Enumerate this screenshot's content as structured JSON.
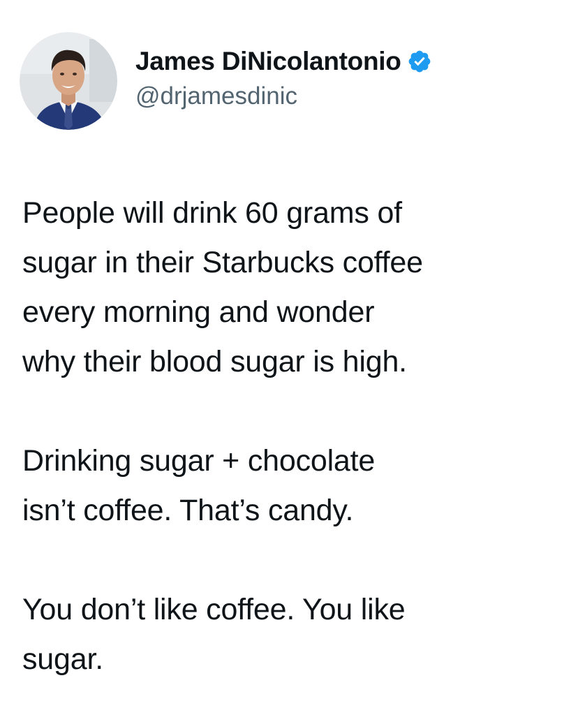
{
  "author": {
    "display_name": "James DiNicolantonio",
    "handle": "@drjamesdinic",
    "verified": true,
    "avatar_icon": "profile-photo-man-in-suit"
  },
  "colors": {
    "text": "#0f1419",
    "secondary_text": "#536471",
    "verified_badge": "#1d9bf0"
  },
  "tweet": {
    "paragraphs": [
      {
        "lines": [
          "People will drink 60 grams of",
          "sugar in their Starbucks coffee",
          "every morning and wonder",
          "why their blood sugar is high."
        ]
      },
      {
        "lines": [
          "Drinking sugar + chocolate",
          "isn’t coffee. That’s candy."
        ]
      },
      {
        "lines": [
          "You don’t like coffee. You like",
          "sugar."
        ]
      }
    ]
  }
}
